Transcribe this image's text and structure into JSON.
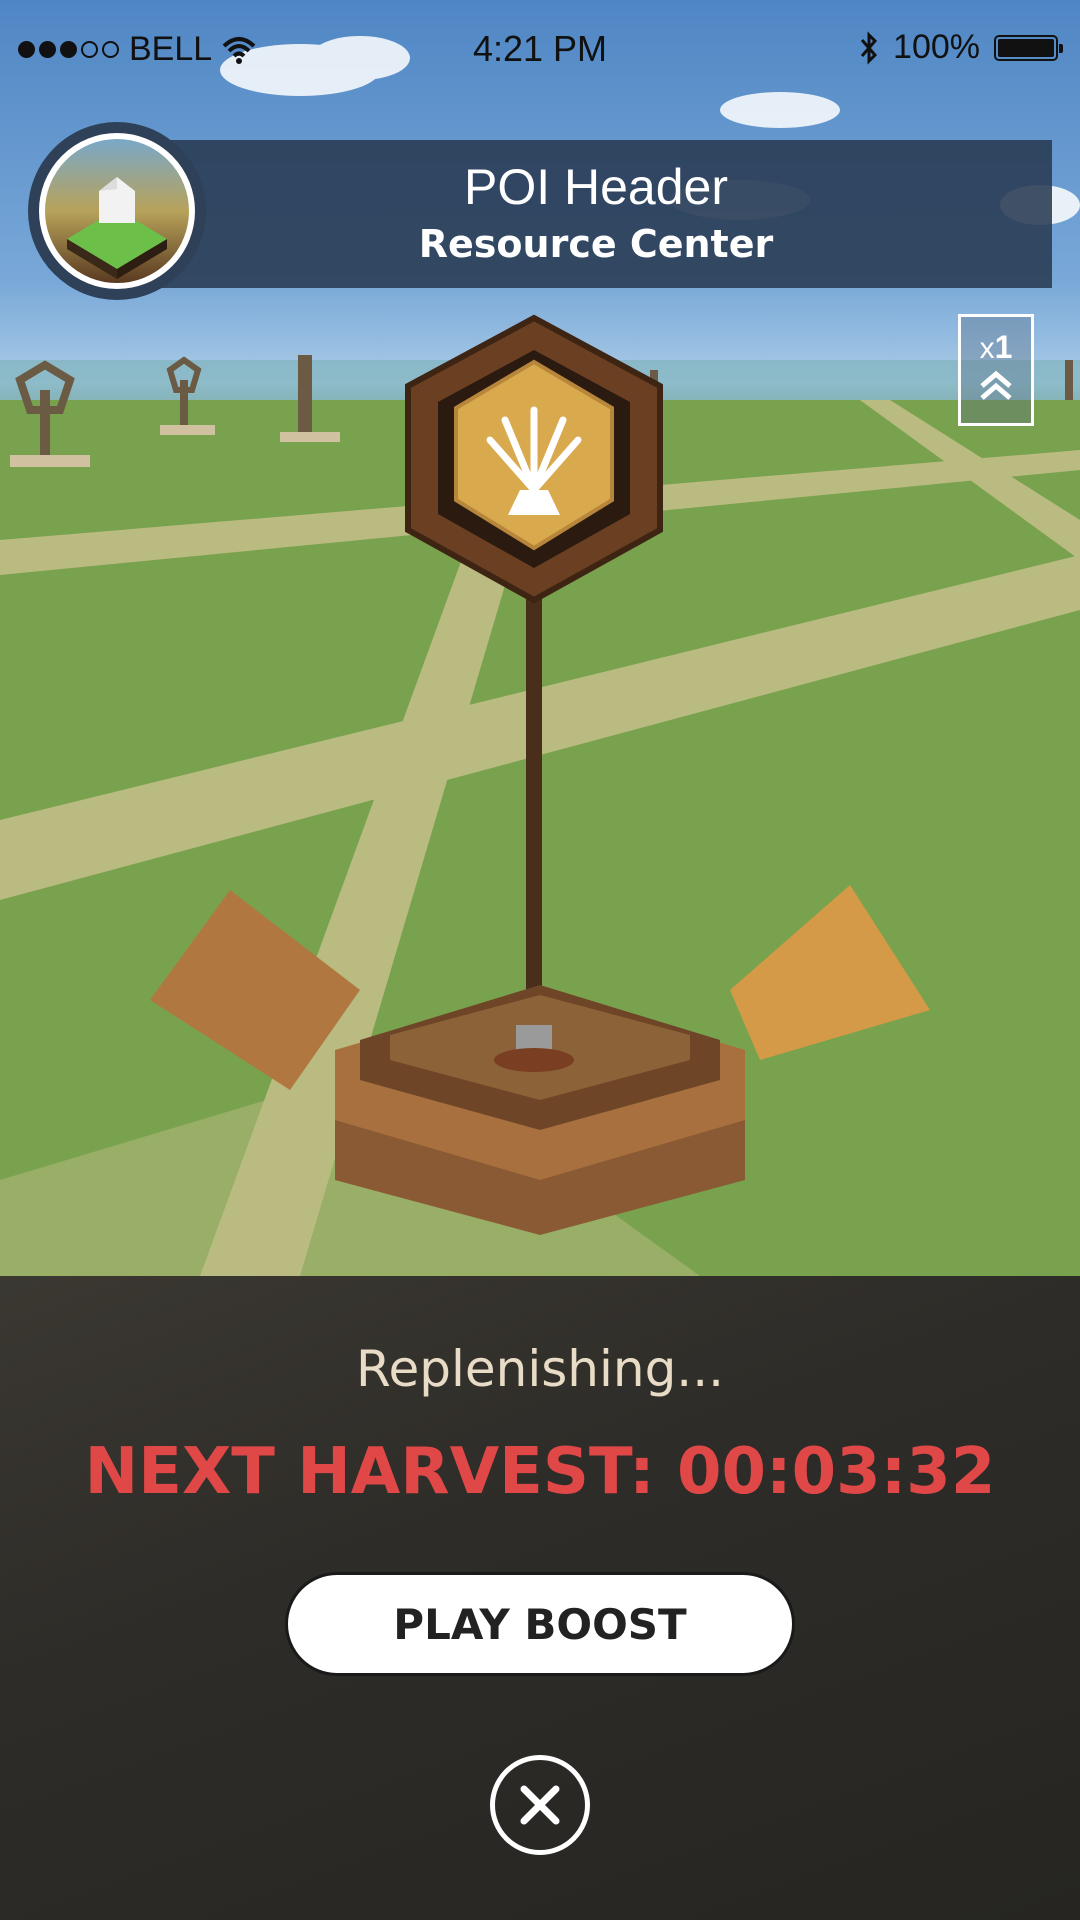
{
  "status_bar": {
    "carrier": "BELL",
    "time": "4:21 PM",
    "battery": "100%",
    "signal_bars_filled": 3,
    "signal_bars_total": 5
  },
  "poi": {
    "header_title": "POI Header",
    "header_subtitle": "Resource Center",
    "multiplier_prefix": "x",
    "multiplier_value": "1"
  },
  "panel": {
    "status_text": "Replenishing...",
    "harvest_text": "NEXT HARVEST: 00:03:32",
    "boost_label": "PLAY BOOST"
  },
  "icons": {
    "avatar": "resource-center-thumbnail-icon",
    "sign": "wheat-bundle-icon",
    "multiplier": "double-chevron-up-icon",
    "close": "close-icon"
  },
  "colors": {
    "header_bg": "#283a52",
    "harvest_red": "#e04848",
    "panel_bg": "#2e2c28",
    "status_text": "#e9dcc6"
  }
}
